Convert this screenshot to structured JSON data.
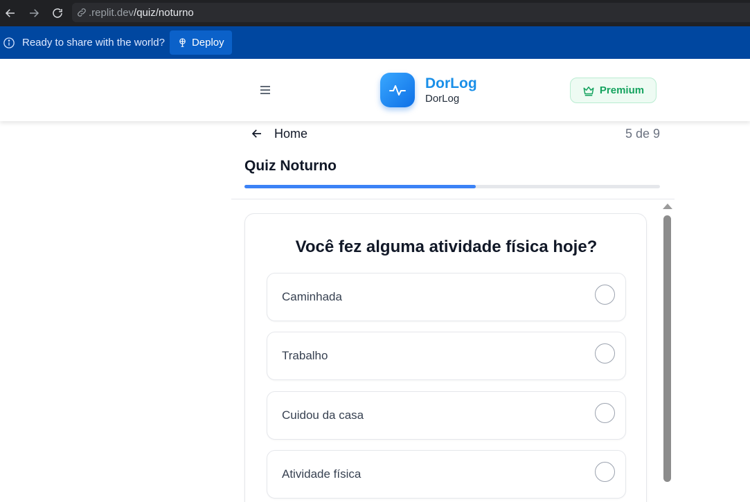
{
  "browser": {
    "url_domain": ".replit.dev",
    "url_path": "/quiz/noturno",
    "icons": [
      "arrow-back-icon",
      "arrow-forward-icon",
      "reload-icon",
      "link-icon"
    ]
  },
  "banner": {
    "text": "Ready to share with the world?",
    "deploy_label": "Deploy",
    "color": "#0047a0"
  },
  "header": {
    "brand_title": "DorLog",
    "brand_subtitle": "DorLog",
    "premium_label": "Premium",
    "accent_color": "#1a8fe8",
    "premium_color": "#15a35f"
  },
  "quiz": {
    "back_label": "Home",
    "step_text": "5 de 9",
    "title": "Quiz Noturno",
    "progress": 0.556,
    "question": "Você fez alguma atividade física hoje?",
    "options": [
      {
        "label": "Caminhada",
        "selected": false
      },
      {
        "label": "Trabalho",
        "selected": false
      },
      {
        "label": "Cuidou da casa",
        "selected": false
      },
      {
        "label": "Atividade física",
        "selected": false
      }
    ]
  }
}
